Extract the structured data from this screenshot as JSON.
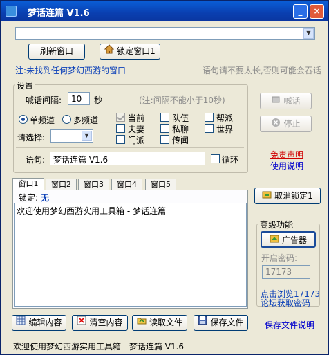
{
  "window": {
    "title": "梦话连篇  V1.6",
    "minimize": "_",
    "close": "×"
  },
  "top": {
    "combo_value": "",
    "refresh_label": "刷新窗口",
    "lock_label": "锁定窗口1",
    "notice": "注:未找到任何梦幻西游的窗口",
    "hint": "语句请不要太长,否则可能会吞话"
  },
  "settings": {
    "title": "设置",
    "interval_label": "喊话间隔:",
    "interval_value": "10",
    "interval_unit": "秒",
    "interval_note": "(注:间隔不能小于10秒)",
    "single_label": "单频道",
    "multi_label": "多频道",
    "select_label": "请选择:",
    "channels": [
      {
        "label": "当前",
        "checked": true
      },
      {
        "label": "队伍",
        "checked": false
      },
      {
        "label": "帮派",
        "checked": false
      },
      {
        "label": "夫妻",
        "checked": false
      },
      {
        "label": "私聊",
        "checked": false
      },
      {
        "label": "世界",
        "checked": false
      },
      {
        "label": "门派",
        "checked": false
      },
      {
        "label": "传闻",
        "checked": false
      }
    ],
    "sentence_label": "语句:",
    "sentence_value": "梦话连篇 V1.6",
    "loop_label": "循环"
  },
  "side": {
    "shout_label": "喊话",
    "stop_label": "停止",
    "disclaimer": "免责声明",
    "manual": "使用说明",
    "unlock_label": "取消锁定1",
    "advanced_title": "高级功能",
    "ad_label": "广告器",
    "pwd_label": "开启密码:",
    "pwd_placeholder": "17173",
    "get_pwd": "点击浏览17173论坛获取密码",
    "save_doc": "保存文件说明"
  },
  "tabs": [
    "窗口1",
    "窗口2",
    "窗口3",
    "窗口4",
    "窗口5"
  ],
  "panel": {
    "lock_label": "锁定:",
    "lock_value": "无",
    "content": "欢迎使用梦幻西游实用工具箱 - 梦话连篇"
  },
  "bottom": {
    "edit_label": "编辑内容",
    "clear_label": "清空内容",
    "read_label": "读取文件",
    "save_label": "保存文件"
  },
  "status": "欢迎使用梦幻西游实用工具箱 - 梦话连篇 V1.6"
}
